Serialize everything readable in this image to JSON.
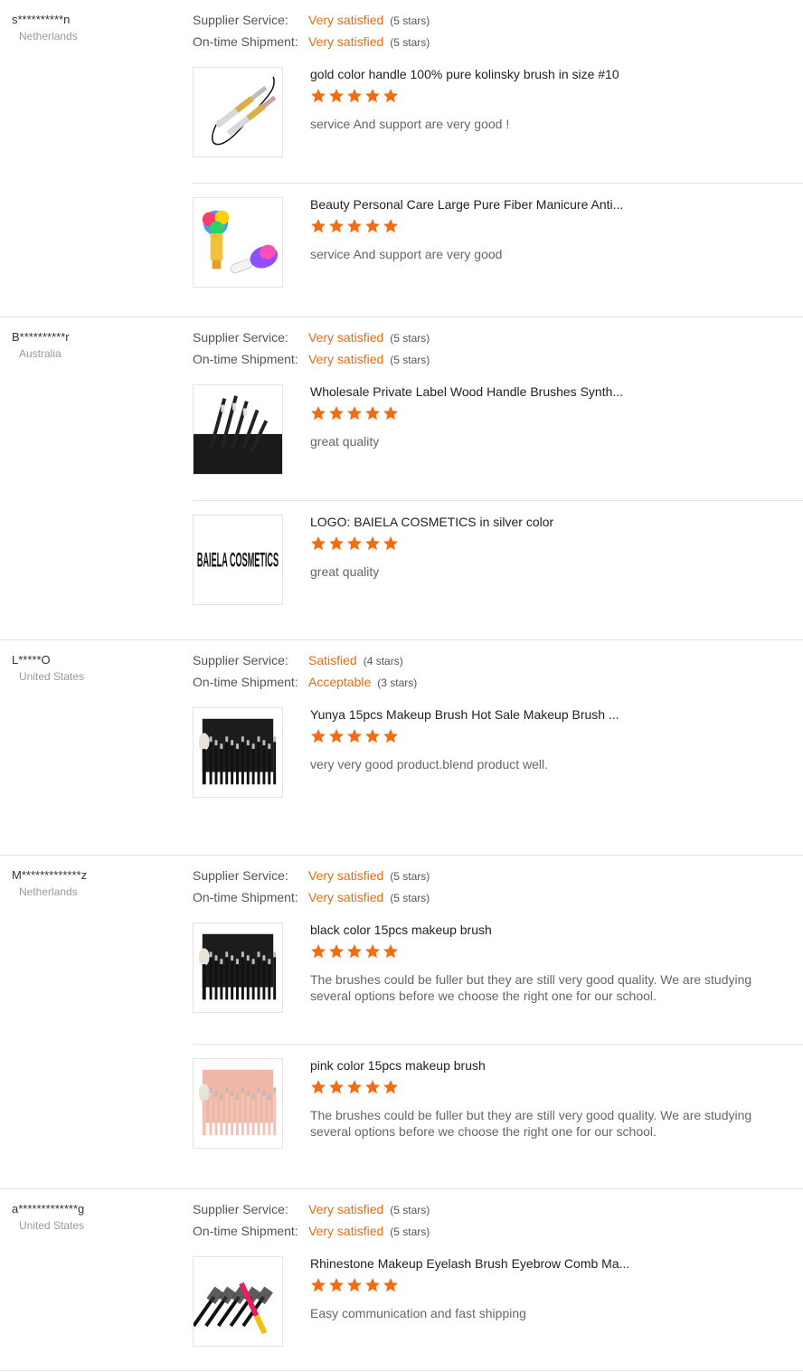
{
  "labels": {
    "supplier": "Supplier Service:",
    "shipment": "On-time Shipment:"
  },
  "colors": {
    "accent": "#e96b12",
    "star": "#f26d12"
  },
  "reviews": [
    {
      "buyer": "s**********n",
      "country": "Netherlands",
      "supplier_value": "Very satisfied",
      "supplier_stars": "(5 stars)",
      "shipment_value": "Very satisfied",
      "shipment_stars": "(5 stars)",
      "products": [
        {
          "title": "gold color handle 100% pure kolinsky brush in size #10",
          "rating": 5,
          "text": "service And support are very good !",
          "thumb": "gold-brush"
        },
        {
          "title": "Beauty Personal Care Large Pure Fiber Manicure Anti...",
          "rating": 5,
          "text": "service And support are very good",
          "thumb": "nail-brush"
        }
      ]
    },
    {
      "buyer": "B**********r",
      "country": "Australia",
      "supplier_value": "Very satisfied",
      "supplier_stars": "(5 stars)",
      "shipment_value": "Very satisfied",
      "shipment_stars": "(5 stars)",
      "products": [
        {
          "title": "Wholesale Private Label Wood Handle Brushes Synth...",
          "rating": 5,
          "text": "great quality",
          "thumb": "brush-bag"
        },
        {
          "title": "LOGO: BAIELA COSMETICS in silver color",
          "rating": 5,
          "text": "great quality",
          "thumb": "logo",
          "logo_text": "BAIELA COSMETICS"
        }
      ]
    },
    {
      "buyer": "L*****O",
      "country": "United States",
      "supplier_value": "Satisfied",
      "supplier_stars": "(4 stars)",
      "shipment_value": "Acceptable",
      "shipment_stars": "(3 stars)",
      "products": [
        {
          "title": "Yunya 15pcs Makeup Brush Hot Sale Makeup Brush ...",
          "rating": 5,
          "text": "very very good product.blend product well.",
          "thumb": "black-set"
        }
      ]
    },
    {
      "buyer": "M*************z",
      "country": "Netherlands",
      "supplier_value": "Very satisfied",
      "supplier_stars": "(5 stars)",
      "shipment_value": "Very satisfied",
      "shipment_stars": "(5 stars)",
      "products": [
        {
          "title": "black color 15pcs makeup brush",
          "rating": 5,
          "text": "The brushes could be fuller but they are still very good quality. We are studying several options before we choose the right one for our school.",
          "thumb": "black-set"
        },
        {
          "title": "pink color 15pcs makeup brush",
          "rating": 5,
          "text": "The brushes could be fuller but they are still very good quality. We are studying several options before we choose the right one for our school.",
          "thumb": "pink-set"
        }
      ]
    },
    {
      "buyer": "a*************g",
      "country": "United States",
      "supplier_value": "Very satisfied",
      "supplier_stars": "(5 stars)",
      "shipment_value": "Very satisfied",
      "shipment_stars": "(5 stars)",
      "products": [
        {
          "title": "Rhinestone Makeup Eyelash Brush Eyebrow Comb Ma...",
          "rating": 5,
          "text": "Easy communication and fast shipping",
          "thumb": "mascara"
        }
      ]
    }
  ]
}
